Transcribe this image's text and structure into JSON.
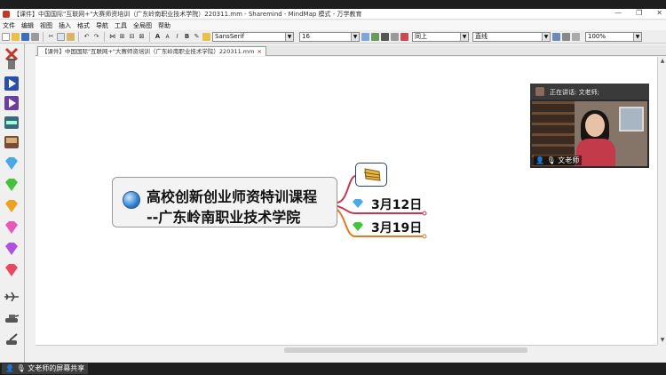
{
  "window": {
    "title": "【课件】中国国际\"互联网+\"大赛师资培训（广东岭南职业技术学院）220311.mm - Sharemind - MindMap 模式 - 万学教育",
    "controls": [
      "—",
      "❐",
      "✕"
    ]
  },
  "menu": {
    "items": [
      "文件",
      "编辑",
      "视图",
      "插入",
      "格式",
      "导航",
      "工具",
      "全局图",
      "帮助"
    ]
  },
  "toolbar": {
    "font_family": "SansSerif",
    "font_size": "16",
    "edge_position": "同上",
    "edge_style": "直线",
    "zoom": "100%"
  },
  "document_tab": {
    "label": "【课件】中国国际\"互联网+\"大赛师资培训（广东岭南职业技术学院）220311.mm",
    "close": "×"
  },
  "mindmap": {
    "root_line1": "高校创新创业师资特训课程",
    "root_line2": "--广东岭南职业技术学院",
    "branches": [
      {
        "label": "3月12日",
        "gem_color": "#4aa8e8",
        "edge_color": "#c8384a"
      },
      {
        "label": "3月19日",
        "gem_color": "#44c23a",
        "edge_color": "#e07a22"
      }
    ],
    "icon_branch_edge_color": "#c8384a"
  },
  "meeting": {
    "speaking_label": "正在讲话: 文老师;",
    "participant_name": "文老师",
    "screen_share_label": "文老师的屏幕共享"
  }
}
